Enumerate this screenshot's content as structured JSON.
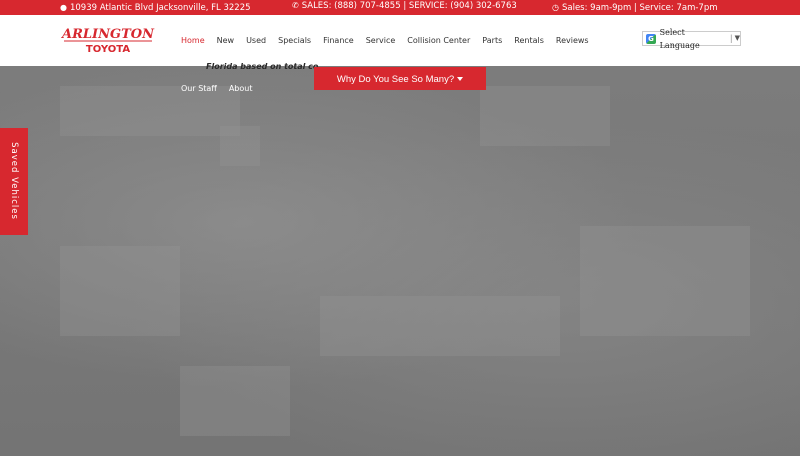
{
  "topbar": {
    "address_icon": "map-marker-icon",
    "address": "10939 Atlantic Blvd Jacksonville, FL 32225",
    "phone_icon": "phone-icon",
    "phones": "SALES: (888) 707-4855 | SERVICE: (904) 302-6763",
    "hours_icon": "clock-icon",
    "hours": "Sales: 9am-9pm | Service: 7am-7pm",
    "background": "#d7282f"
  },
  "header": {
    "logo_line1": "ARLINGTON",
    "logo_line2": "TOYOTA",
    "nav": [
      {
        "label": "Home",
        "active": true
      },
      {
        "label": "New"
      },
      {
        "label": "Used"
      },
      {
        "label": "Specials"
      },
      {
        "label": "Finance"
      },
      {
        "label": "Service"
      },
      {
        "label": "Collision Center"
      },
      {
        "label": "Parts"
      },
      {
        "label": "Rentals"
      },
      {
        "label": "Reviews"
      }
    ],
    "nav_row2": [
      {
        "label": "Our Staff"
      },
      {
        "label": "About"
      }
    ],
    "language": "Select Language"
  },
  "hero": {
    "caption": "Florida based on total co",
    "why_button": "Why Do You See So Many?"
  },
  "saved_vehicles": "Saved Vehicles",
  "colors": {
    "accent": "#d7282f",
    "active_nav": "#d7282f"
  }
}
